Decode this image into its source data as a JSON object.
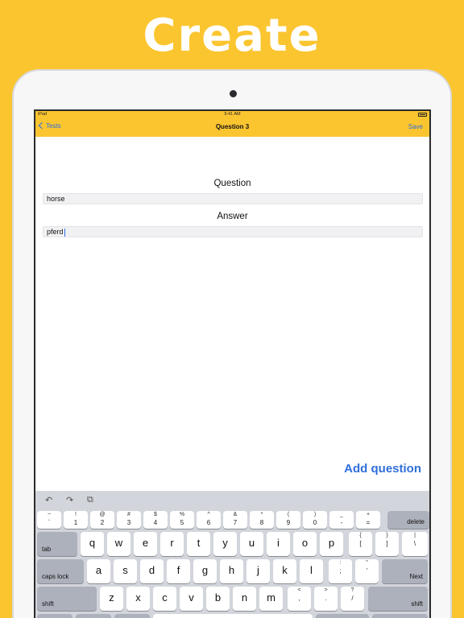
{
  "headline": "Create",
  "status_bar": {
    "left": "iPad",
    "time": "9:41 AM"
  },
  "nav": {
    "back_label": "Tests",
    "title": "Question 3",
    "save_label": "Save"
  },
  "form": {
    "question_label": "Question",
    "question_value": "horse",
    "answer_label": "Answer",
    "answer_value": "pferd"
  },
  "add_question_label": "Add question",
  "keyboard": {
    "toolbar_icons": [
      "undo-icon",
      "redo-icon",
      "paste-icon"
    ],
    "number_row": [
      {
        "top": "~",
        "bottom": "`"
      },
      {
        "top": "!",
        "bottom": "1"
      },
      {
        "top": "@",
        "bottom": "2"
      },
      {
        "top": "#",
        "bottom": "3"
      },
      {
        "top": "$",
        "bottom": "4"
      },
      {
        "top": "%",
        "bottom": "5"
      },
      {
        "top": "^",
        "bottom": "6"
      },
      {
        "top": "&",
        "bottom": "7"
      },
      {
        "top": "*",
        "bottom": "8"
      },
      {
        "top": "(",
        "bottom": "9"
      },
      {
        "top": ")",
        "bottom": "0"
      },
      {
        "top": "_",
        "bottom": "-"
      },
      {
        "top": "+",
        "bottom": "="
      }
    ],
    "delete_label": "delete",
    "tab_label": "tab",
    "row_q": [
      "q",
      "w",
      "e",
      "r",
      "t",
      "y",
      "u",
      "i",
      "o",
      "p"
    ],
    "row_q_symbols": [
      {
        "top": "{",
        "bottom": "["
      },
      {
        "top": "}",
        "bottom": "]"
      },
      {
        "top": "|",
        "bottom": "\\"
      }
    ],
    "caps_label": "caps lock",
    "row_a": [
      "a",
      "s",
      "d",
      "f",
      "g",
      "h",
      "j",
      "k",
      "l"
    ],
    "row_a_symbols": [
      {
        "top": ":",
        "bottom": ";"
      },
      {
        "top": "\"",
        "bottom": "'"
      }
    ],
    "next_label": "Next",
    "shift_label": "shift",
    "row_z": [
      "z",
      "x",
      "c",
      "v",
      "b",
      "n",
      "m"
    ],
    "row_z_symbols": [
      {
        "top": "<",
        "bottom": ","
      },
      {
        "top": ">",
        "bottom": "."
      },
      {
        "top": "?",
        "bottom": "/"
      }
    ]
  }
}
